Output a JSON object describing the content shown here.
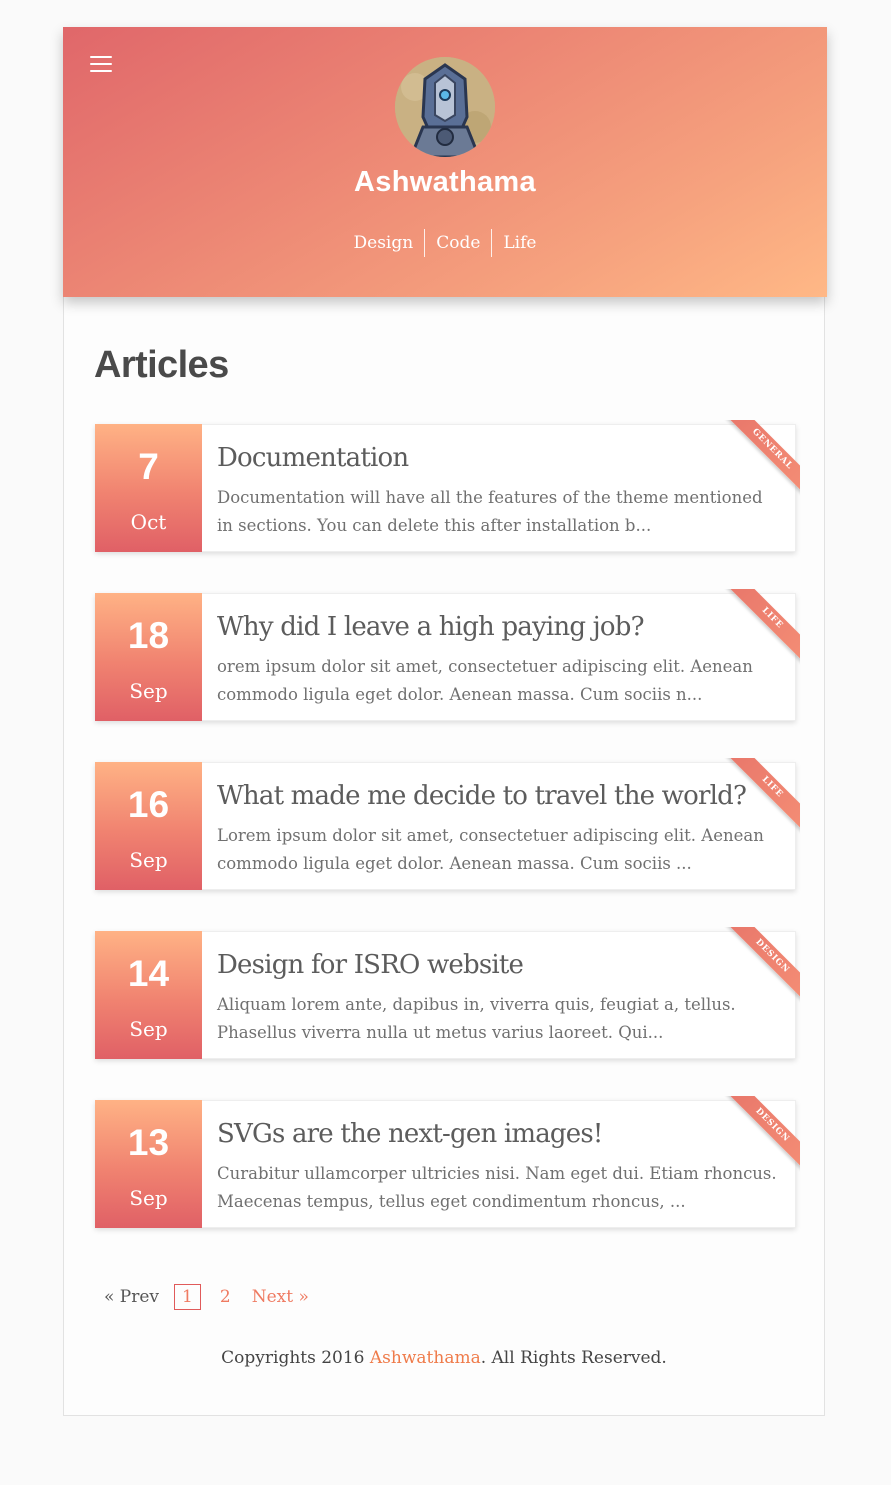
{
  "header": {
    "site_title": "Ashwathama",
    "nav": [
      "Design",
      "Code",
      "Life"
    ]
  },
  "main": {
    "heading": "Articles",
    "articles": [
      {
        "day": "7",
        "month": "Oct",
        "title": "Documentation",
        "excerpt": "Documentation will have all the features of the theme mentioned in sections. You can delete this after installation b...",
        "tag": "General"
      },
      {
        "day": "18",
        "month": "Sep",
        "title": "Why did I leave a high paying job?",
        "excerpt": "orem ipsum dolor sit amet, consectetuer adipiscing elit. Aenean commodo ligula eget dolor. Aenean massa. Cum sociis n...",
        "tag": "Life"
      },
      {
        "day": "16",
        "month": "Sep",
        "title": "What made me decide to travel the world?",
        "excerpt": "Lorem ipsum dolor sit amet, consectetuer adipiscing elit. Aenean commodo ligula eget dolor. Aenean massa. Cum sociis ...",
        "tag": "Life"
      },
      {
        "day": "14",
        "month": "Sep",
        "title": "Design for ISRO website",
        "excerpt": "Aliquam lorem ante, dapibus in, viverra quis, feugiat a, tellus. Phasellus viverra nulla ut metus varius laoreet. Qui...",
        "tag": "Design"
      },
      {
        "day": "13",
        "month": "Sep",
        "title": "SVGs are the next-gen images!",
        "excerpt": "Curabitur ullamcorper ultricies nisi. Nam eget dui. Etiam rhoncus. Maecenas tempus, tellus eget condimentum rhoncus, ...",
        "tag": "Design"
      }
    ]
  },
  "pagination": {
    "prev_label": "« Prev",
    "pages": [
      "1",
      "2"
    ],
    "current": "1",
    "next_label": "Next »"
  },
  "footer": {
    "prefix": "Copyrights 2016 ",
    "brand": "Ashwathama",
    "suffix": ". All Rights Reserved."
  },
  "colors": {
    "accent": "#ef7b62",
    "header_gradient_start": "#e0676a",
    "header_gradient_end": "#ffb886"
  },
  "icons": {
    "menu": "hamburger-menu-icon",
    "avatar": "robot-avatar"
  }
}
